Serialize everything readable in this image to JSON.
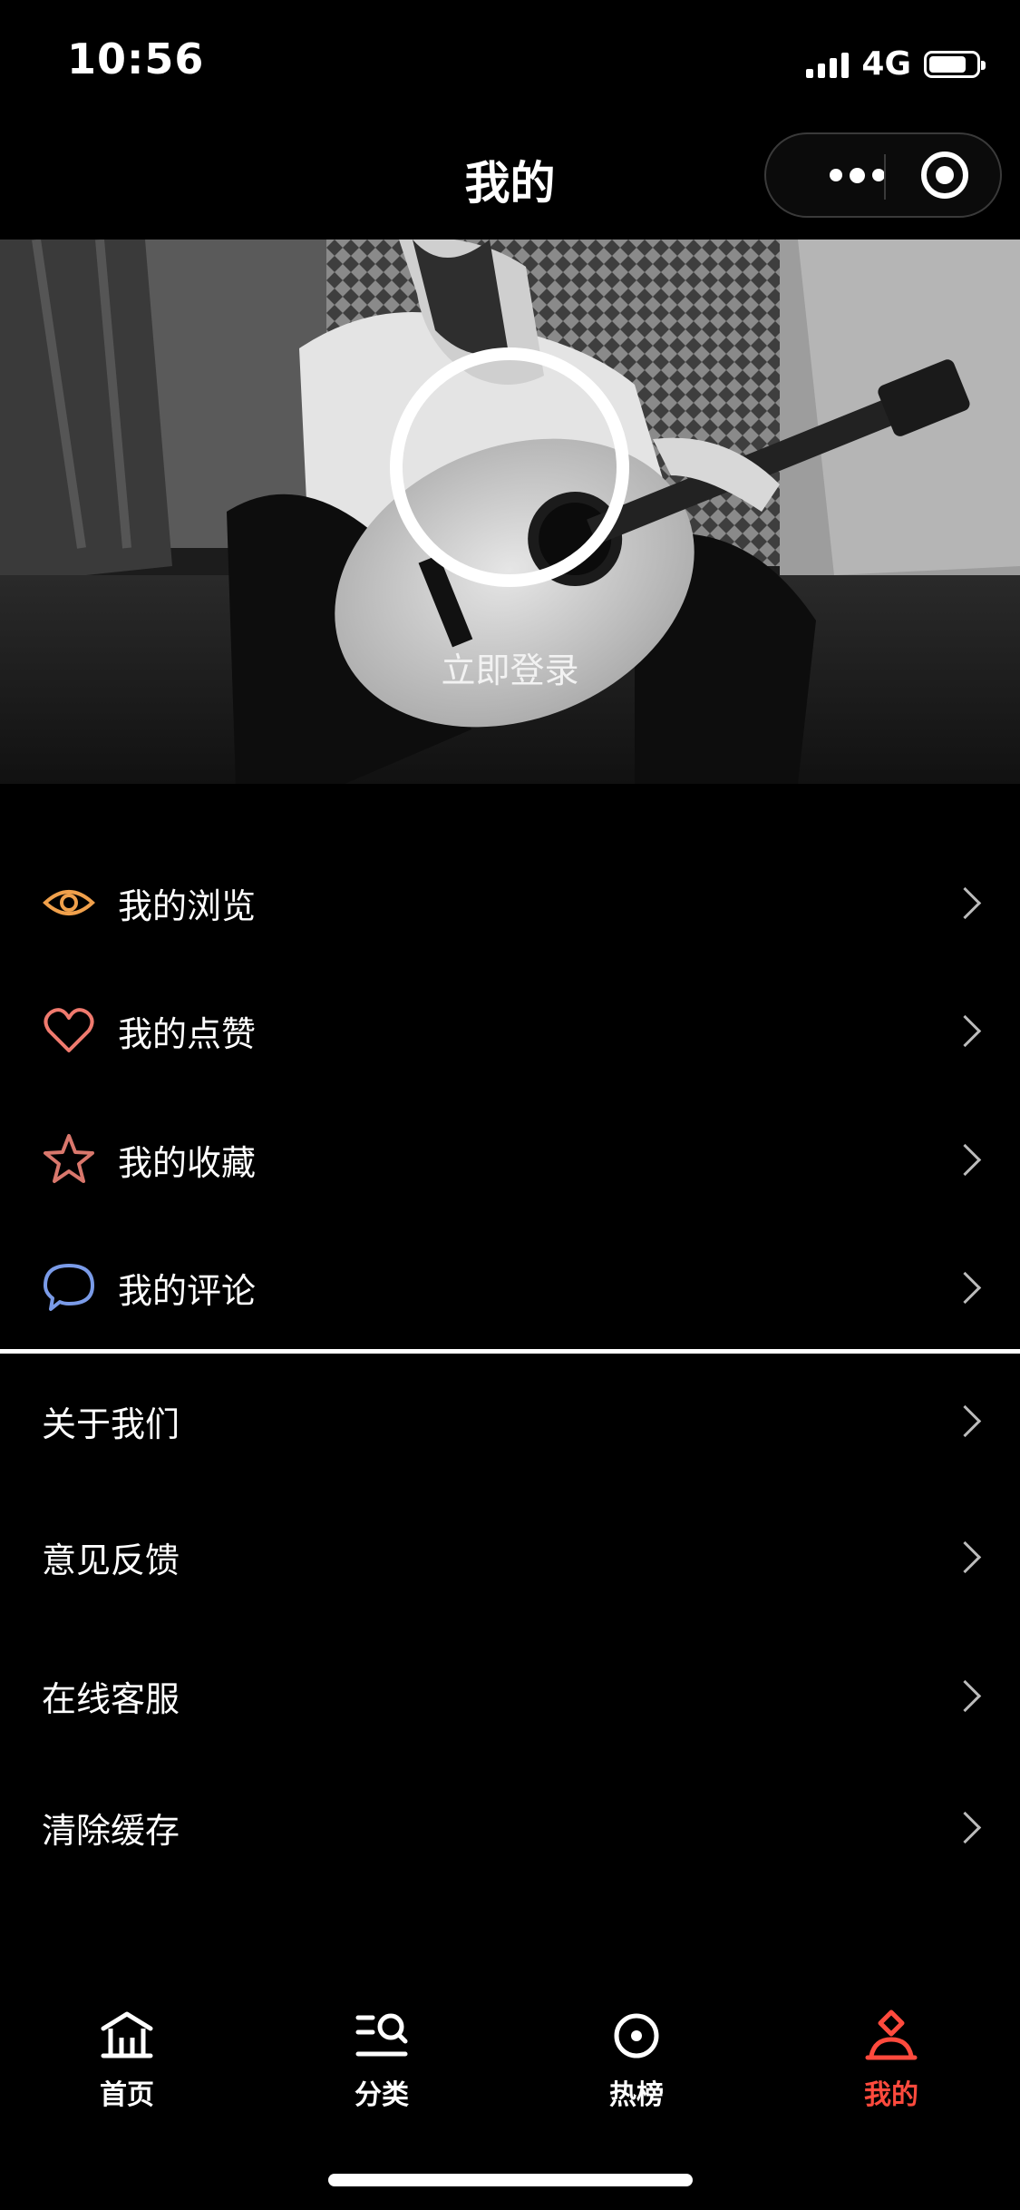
{
  "status_bar": {
    "time": "10:56",
    "network": "4G"
  },
  "nav": {
    "title": "我的"
  },
  "profile": {
    "login_text": "立即登录"
  },
  "menu_primary": [
    {
      "label": "我的浏览",
      "icon": "eye-icon",
      "color": "#f0a04b"
    },
    {
      "label": "我的点赞",
      "icon": "heart-icon",
      "color": "#f07a6e"
    },
    {
      "label": "我的收藏",
      "icon": "star-icon",
      "color": "#d9776c"
    },
    {
      "label": "我的评论",
      "icon": "comment-icon",
      "color": "#7a9be8"
    }
  ],
  "menu_secondary": [
    {
      "label": "关于我们"
    },
    {
      "label": "意见反馈"
    },
    {
      "label": "在线客服"
    },
    {
      "label": "清除缓存"
    }
  ],
  "tabbar": {
    "items": [
      {
        "label": "首页",
        "icon": "home-icon"
      },
      {
        "label": "分类",
        "icon": "category-search-icon"
      },
      {
        "label": "热榜",
        "icon": "hot-list-icon"
      },
      {
        "label": "我的",
        "icon": "user-icon",
        "active": true
      }
    ],
    "active_color": "#ff4a3d"
  }
}
